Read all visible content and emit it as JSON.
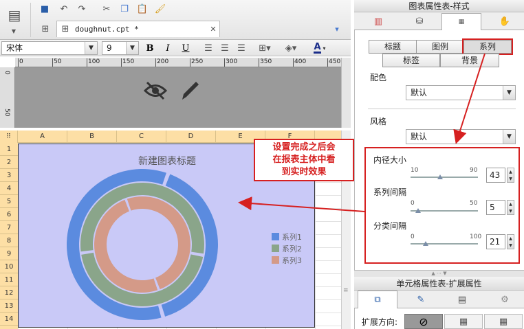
{
  "toolbar": {
    "file_tab": "doughnut.cpt *",
    "font": "宋体",
    "font_size": "9",
    "bold": "B",
    "italic": "I",
    "underline": "U",
    "color_a": "A"
  },
  "ruler": {
    "ticks": [
      "0",
      "50",
      "100",
      "150",
      "200",
      "250",
      "300",
      "350",
      "400",
      "450"
    ],
    "vticks": [
      "0",
      "50"
    ]
  },
  "sheet": {
    "columns": [
      "A",
      "B",
      "C",
      "D",
      "E",
      "F"
    ],
    "rows": [
      "1",
      "2",
      "3",
      "4",
      "5",
      "6",
      "7",
      "8",
      "9",
      "10",
      "11",
      "12",
      "13",
      "14"
    ]
  },
  "chart_data": {
    "type": "doughnut",
    "title": "新建图表标题",
    "series": [
      {
        "name": "系列1",
        "color": "#5b8bdf",
        "values": [
          40,
          60
        ]
      },
      {
        "name": "系列2",
        "color": "#8aa58a",
        "values": [
          45,
          55
        ]
      },
      {
        "name": "系列3",
        "color": "#d49a88",
        "values": [
          50,
          50
        ]
      }
    ]
  },
  "annotation": {
    "line1": "设置完成之后会",
    "line2": "在报表主体中看",
    "line3": "到实时效果"
  },
  "panel": {
    "title": "图表属性表-样式",
    "subtabs": [
      "标题",
      "图例",
      "系列"
    ],
    "subtabs2": [
      "标签",
      "背景"
    ],
    "color_label": "配色",
    "color_value": "默认",
    "style_label": "风格",
    "style_value": "默认",
    "inner_label": "内径大小",
    "inner_min": "10",
    "inner_max": "90",
    "inner_value": "43",
    "series_gap_label": "系列间隔",
    "series_gap_min": "0",
    "series_gap_max": "50",
    "series_gap_value": "5",
    "cat_gap_label": "分类间隔",
    "cat_gap_min": "0",
    "cat_gap_max": "100",
    "cat_gap_value": "21"
  },
  "cell_panel": {
    "title": "单元格属性表-扩展属性",
    "expand_label": "扩展方向:"
  }
}
